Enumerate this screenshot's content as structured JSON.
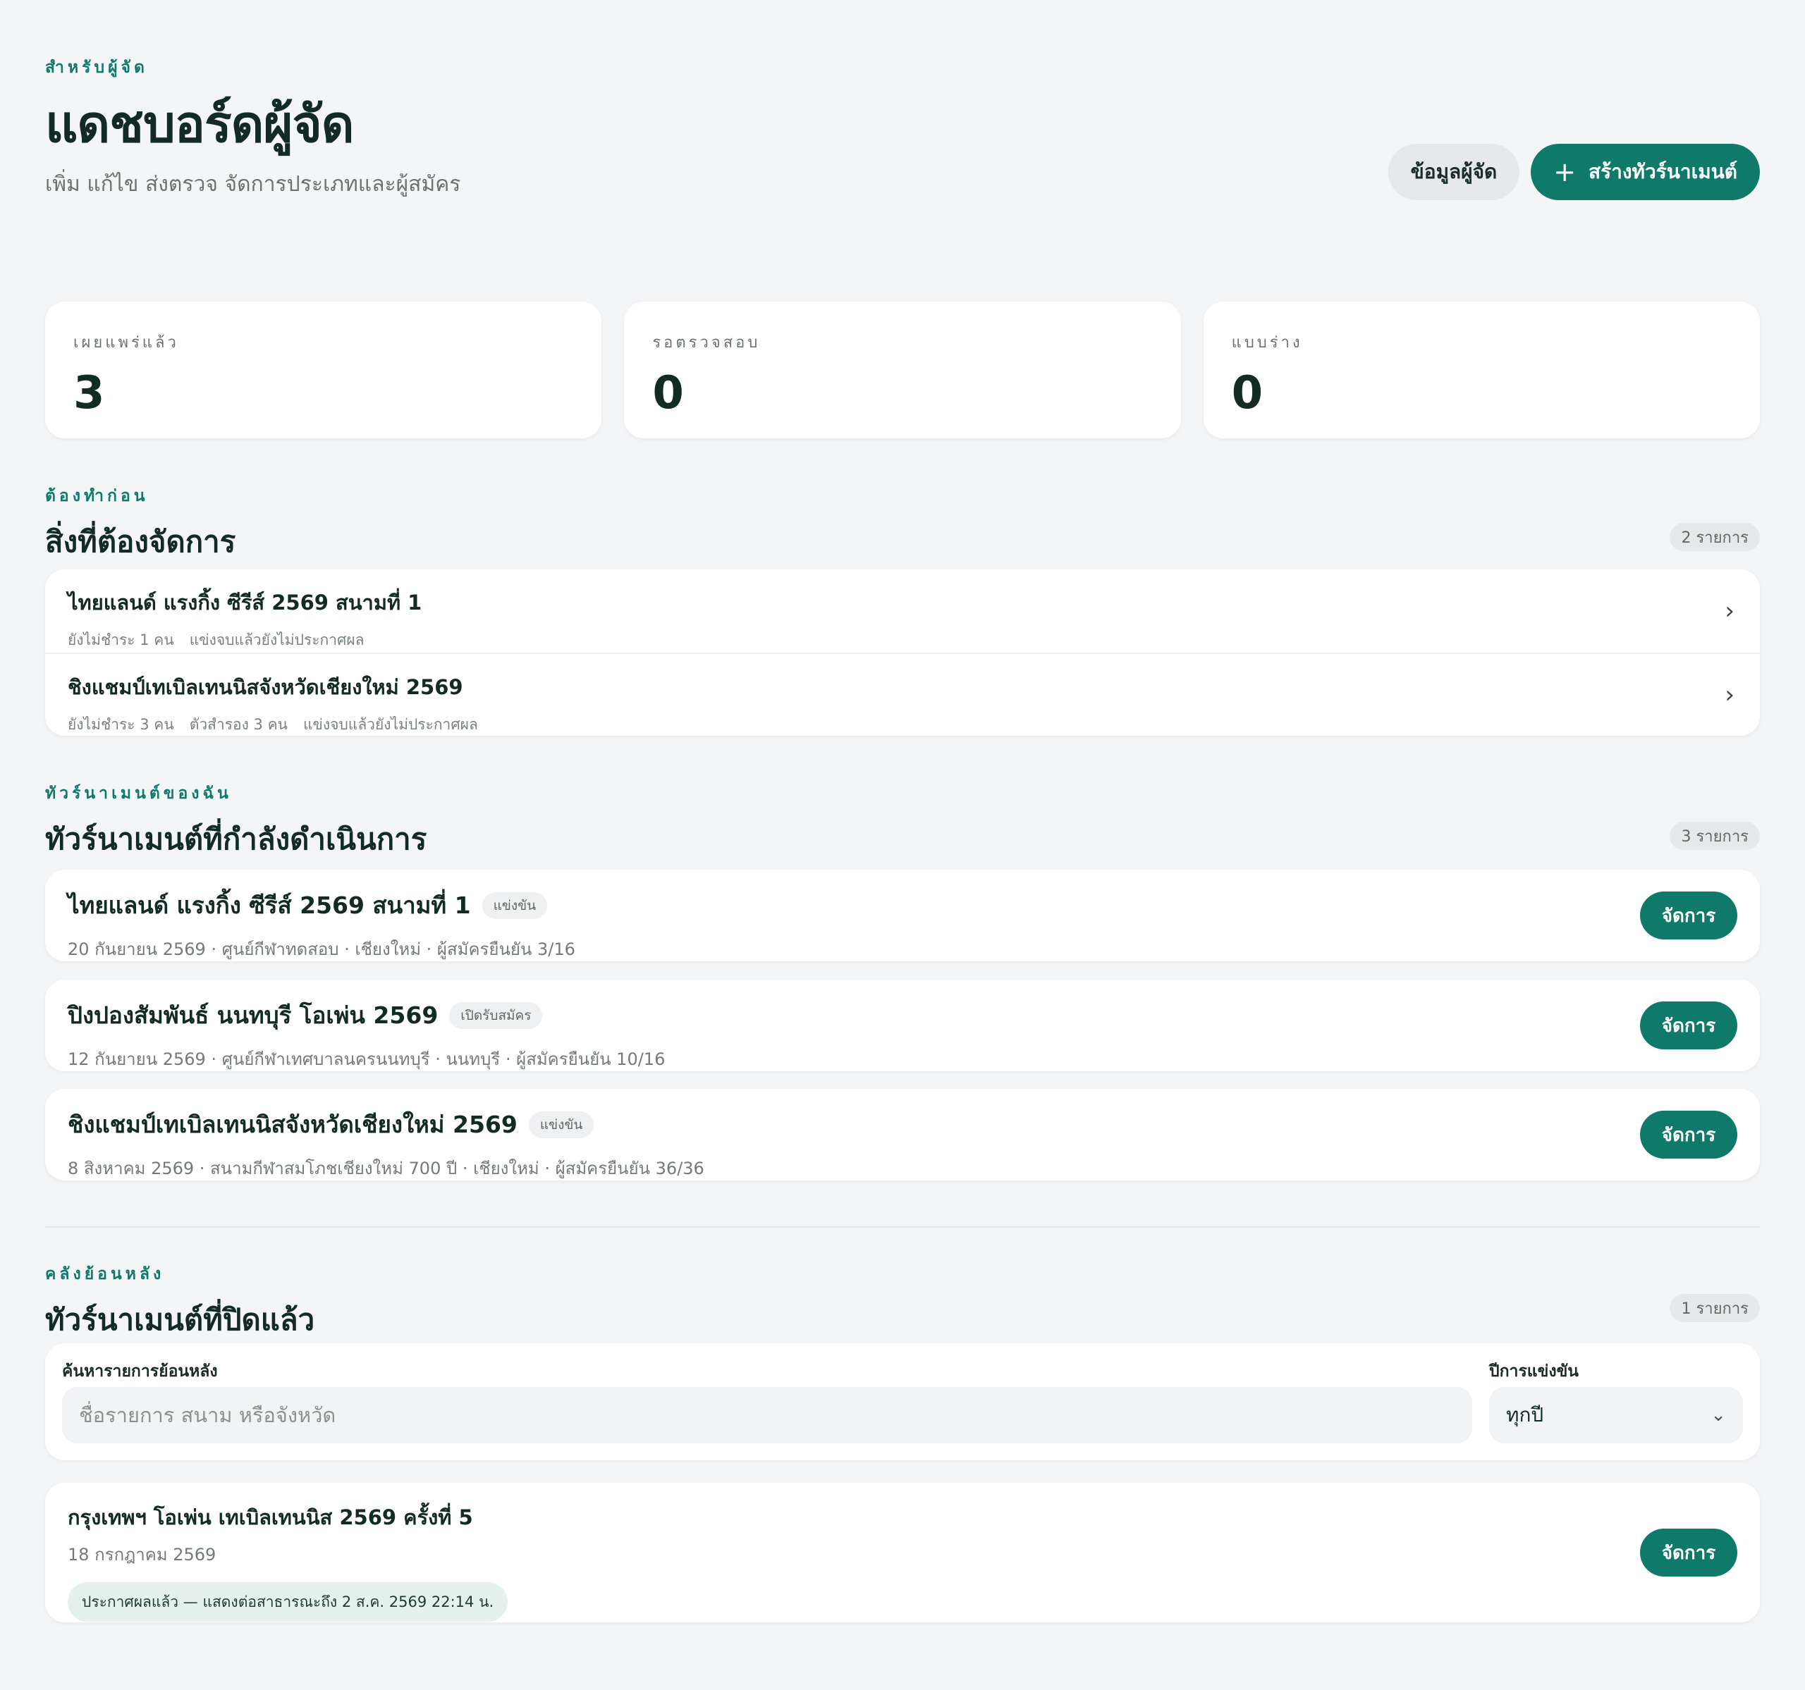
{
  "header": {
    "eyebrow": "สำหรับผู้จัด",
    "title": "แดชบอร์ดผู้จัด",
    "subtitle": "เพิ่ม แก้ไข ส่งตรวจ จัดการประเภทและผู้สมัคร",
    "info_button": "ข้อมูลผู้จัด",
    "create_button": "สร้างทัวร์นาเมนต์",
    "create_icon": "plus-icon"
  },
  "stats": [
    {
      "label": "เผยแพร่แล้ว",
      "value": "3"
    },
    {
      "label": "รอตรวจสอบ",
      "value": "0"
    },
    {
      "label": "แบบร่าง",
      "value": "0"
    }
  ],
  "todo": {
    "eyebrow": "ต้องทำก่อน",
    "title": "สิ่งที่ต้องจัดการ",
    "count": "2 รายการ",
    "items": [
      {
        "title": "ไทยแลนด์ แรงกิ้ง ซีรีส์ 2569 สนามที่ 1",
        "meta": [
          "ยังไม่ชำระ 1 คน",
          "แข่งจบแล้วยังไม่ประกาศผล"
        ]
      },
      {
        "title": "ชิงแชมป์เทเบิลเทนนิสจังหวัดเชียงใหม่ 2569",
        "meta": [
          "ยังไม่ชำระ 3 คน",
          "ตัวสำรอง 3 คน",
          "แข่งจบแล้วยังไม่ประกาศผล"
        ]
      }
    ]
  },
  "active": {
    "eyebrow": "ทัวร์นาเมนต์ของฉัน",
    "title": "ทัวร์นาเมนต์ที่กำลังดำเนินการ",
    "count": "3 รายการ",
    "manage_label": "จัดการ",
    "items": [
      {
        "title": "ไทยแลนด์ แรงกิ้ง ซีรีส์ 2569 สนามที่ 1",
        "badge": "แข่งขัน",
        "meta": "20 กันยายน 2569 · ศูนย์กีฬาทดสอบ · เชียงใหม่ · ผู้สมัครยืนยัน 3/16"
      },
      {
        "title": "ปิงปองสัมพันธ์ นนทบุรี โอเพ่น 2569",
        "badge": "เปิดรับสมัคร",
        "meta": "12 กันยายน 2569 · ศูนย์กีฬาเทศบาลนครนนทบุรี · นนทบุรี · ผู้สมัครยืนยัน 10/16"
      },
      {
        "title": "ชิงแชมป์เทเบิลเทนนิสจังหวัดเชียงใหม่ 2569",
        "badge": "แข่งขัน",
        "meta": "8 สิงหาคม 2569 · สนามกีฬาสมโภชเชียงใหม่ 700 ปี · เชียงใหม่ · ผู้สมัครยืนยัน 36/36"
      }
    ]
  },
  "archive": {
    "eyebrow": "คลังย้อนหลัง",
    "title": "ทัวร์นาเมนต์ที่ปิดแล้ว",
    "count": "1 รายการ",
    "search_label": "ค้นหารายการย้อนหลัง",
    "search_placeholder": "ชื่อรายการ สนาม หรือจังหวัด",
    "search_value": "",
    "year_label": "ปีการแข่งขัน",
    "year_value": "ทุกปี",
    "items": [
      {
        "title": "กรุงเทพฯ โอเพ่น เทเบิลเทนนิส 2569 ครั้งที่ 5",
        "date": "18 กรกฎาคม 2569",
        "notice": "ประกาศผลแล้ว — แสดงต่อสาธารณะถึง 2 ส.ค. 2569 22:14 น.",
        "manage_label": "จัดการ"
      }
    ]
  },
  "colors": {
    "accent": "#0f7a6a",
    "background": "#f4f5f7",
    "card": "#ffffff",
    "notice_bg": "#e4f1ec"
  }
}
